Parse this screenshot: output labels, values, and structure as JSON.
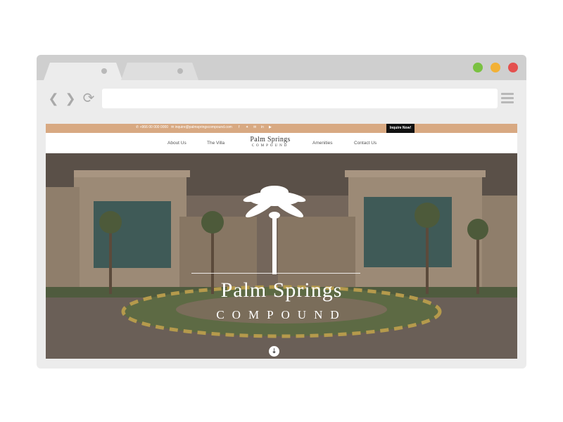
{
  "browser": {
    "window_buttons": [
      "#7ac142",
      "#f2b136",
      "#e4504e"
    ],
    "nav_icons": [
      "back-icon",
      "forward-icon",
      "reload-icon",
      "menu-icon"
    ],
    "address": ""
  },
  "site": {
    "topbar": {
      "phone": "+966 00 000 0000",
      "email": "inquire@palmspringscompound.com",
      "social": [
        "facebook-icon",
        "twitter-icon",
        "email-icon",
        "linkedin-icon",
        "youtube-icon"
      ],
      "cta": "Inquire Now!"
    },
    "nav": {
      "left": [
        "About Us",
        "The Villa"
      ],
      "right": [
        "Amenities",
        "Contact Us"
      ],
      "logo_line1": "Palm Springs",
      "logo_line2": "COMPOUND"
    },
    "hero": {
      "title": "Palm Springs",
      "subtitle": "COMPOUND",
      "scroll_icon": "chevrons-down-icon"
    },
    "colors": {
      "topbar": "#d8a982",
      "cta": "#111111",
      "overlay": "#6f5f52"
    }
  }
}
